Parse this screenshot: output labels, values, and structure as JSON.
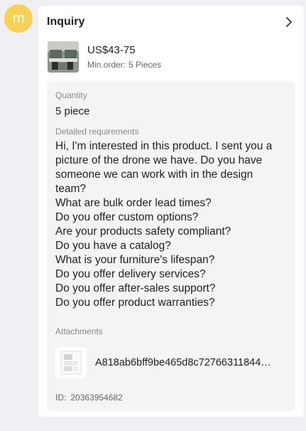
{
  "user": {
    "avatar_letter": "m",
    "avatar_color": "#f7d154"
  },
  "inquiry": {
    "title": "Inquiry",
    "chevron_icon": "chevron-right-icon",
    "product": {
      "price": "US$43-75",
      "min_order_label": "Min.order:",
      "min_order_value": "5 Pieces"
    },
    "quantity_label": "Quantity",
    "quantity_value": "5 piece",
    "requirements_label": "Detailed requirements",
    "requirements_lines": [
      "Hi, I'm interested in this product. I sent you a",
      "picture of the drone we have. Do you have",
      "someone we can work with in the design",
      "team?",
      "What are bulk order lead times?",
      "Do you offer custom options?",
      "Are your products safety compliant?",
      "Do you have a catalog?",
      "What is your furniture's lifespan?",
      "Do you offer delivery services?",
      "Do you offer after-sales support?",
      "Do you offer product warranties?"
    ],
    "attachments_label": "Attachments",
    "attachment_file_name": "A818ab6bff9be465d8c72766311844…",
    "id_label": "ID:",
    "id_value": "20363954682"
  }
}
